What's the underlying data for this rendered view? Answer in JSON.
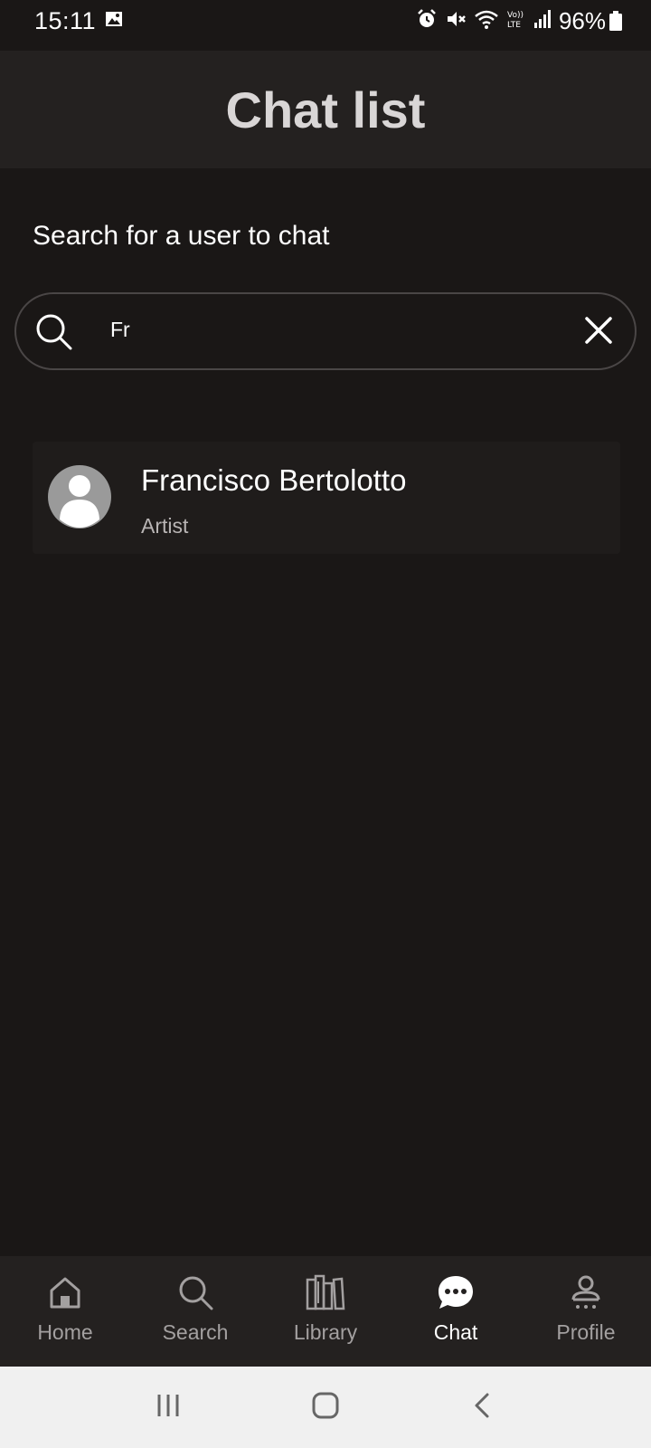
{
  "status_bar": {
    "time": "15:11",
    "battery": "96%",
    "icons": [
      "gallery-icon",
      "alarm-icon",
      "mute-icon",
      "wifi-icon",
      "volte-icon",
      "signal-icon",
      "battery-icon"
    ]
  },
  "header": {
    "title": "Chat list"
  },
  "search": {
    "label": "Search for a user to chat",
    "value": "Fr"
  },
  "results": [
    {
      "name": "Francisco Bertolotto",
      "role": "Artist"
    }
  ],
  "bottom_nav": {
    "items": [
      {
        "label": "Home",
        "icon": "home-icon",
        "active": false
      },
      {
        "label": "Search",
        "icon": "search-icon",
        "active": false
      },
      {
        "label": "Library",
        "icon": "library-icon",
        "active": false
      },
      {
        "label": "Chat",
        "icon": "chat-icon",
        "active": true
      },
      {
        "label": "Profile",
        "icon": "profile-icon",
        "active": false
      }
    ]
  },
  "system_nav": {
    "icons": [
      "recents-icon",
      "home-button-icon",
      "back-icon"
    ]
  },
  "colors": {
    "background": "#1a1716",
    "header": "#242120",
    "title": "#d9d6d6",
    "inactive": "#a3a0a0"
  }
}
